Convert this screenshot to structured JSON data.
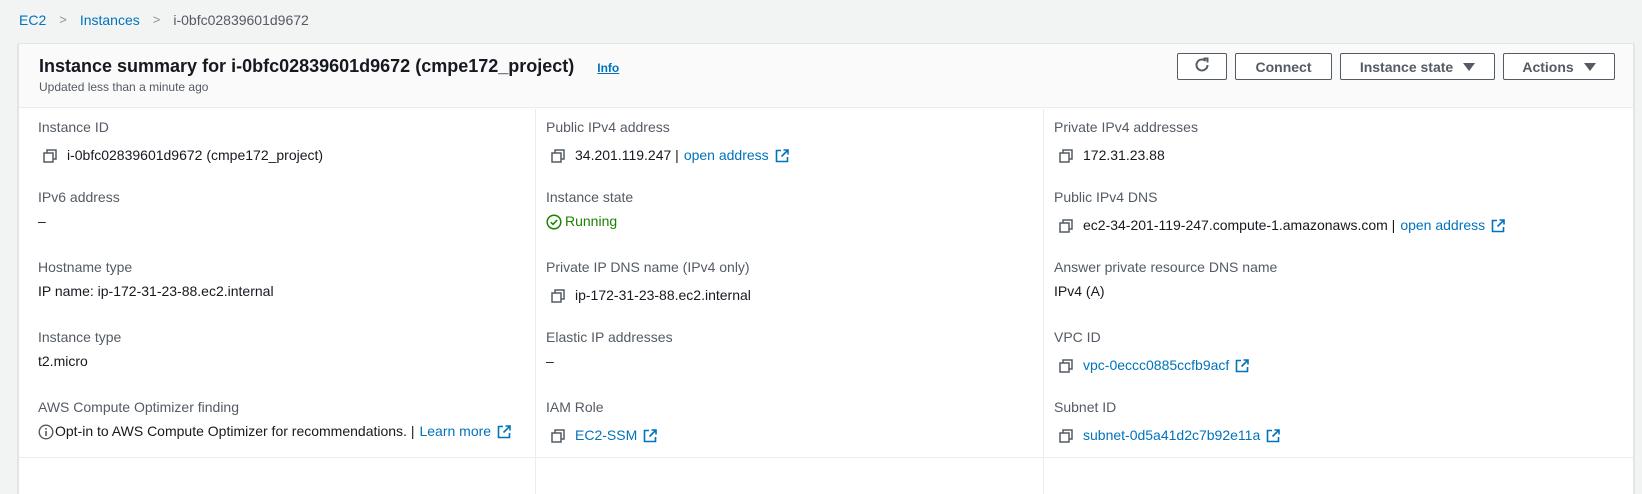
{
  "breadcrumb": {
    "items": [
      "EC2",
      "Instances"
    ],
    "current": "i-0bfc02839601d9672",
    "separator": ">"
  },
  "header": {
    "title": "Instance summary for i-0bfc02839601d9672 (cmpe172_project)",
    "info_label": "Info",
    "subtitle": "Updated less than a minute ago"
  },
  "toolbar": {
    "refresh_icon": "refresh-icon",
    "connect_label": "Connect",
    "instance_state_label": "Instance state",
    "actions_label": "Actions"
  },
  "fields": {
    "instance_id": {
      "label": "Instance ID",
      "value": "i-0bfc02839601d9672 (cmpe172_project)"
    },
    "ipv6": {
      "label": "IPv6 address",
      "value": "–"
    },
    "hostname_type": {
      "label": "Hostname type",
      "value": "IP name: ip-172-31-23-88.ec2.internal"
    },
    "instance_type": {
      "label": "Instance type",
      "value": "t2.micro"
    },
    "optimizer": {
      "label": "AWS Compute Optimizer finding",
      "value": "Opt-in to AWS Compute Optimizer for recommendations. |",
      "link": "Learn more"
    },
    "public_ipv4": {
      "label": "Public IPv4 address",
      "value": "34.201.119.247 |",
      "link": "open address"
    },
    "instance_state": {
      "label": "Instance state",
      "value": "Running"
    },
    "private_ip_dns": {
      "label": "Private IP DNS name (IPv4 only)",
      "value": "ip-172-31-23-88.ec2.internal"
    },
    "elastic_ip": {
      "label": "Elastic IP addresses",
      "value": "–"
    },
    "iam_role": {
      "label": "IAM Role",
      "link": "EC2-SSM"
    },
    "private_ipv4": {
      "label": "Private IPv4 addresses",
      "value": "172.31.23.88"
    },
    "public_dns": {
      "label": "Public IPv4 DNS",
      "value": "ec2-34-201-119-247.compute-1.amazonaws.com |",
      "link": "open address"
    },
    "answer_dns": {
      "label": "Answer private resource DNS name",
      "value": "IPv4 (A)"
    },
    "vpc_id": {
      "label": "VPC ID",
      "link": "vpc-0eccc0885ccfb9acf"
    },
    "subnet_id": {
      "label": "Subnet ID",
      "link": "subnet-0d5a41d2c7b92e11a"
    }
  },
  "colors": {
    "link": "#0073bb",
    "running": "#1d8102",
    "label": "#545b64"
  }
}
